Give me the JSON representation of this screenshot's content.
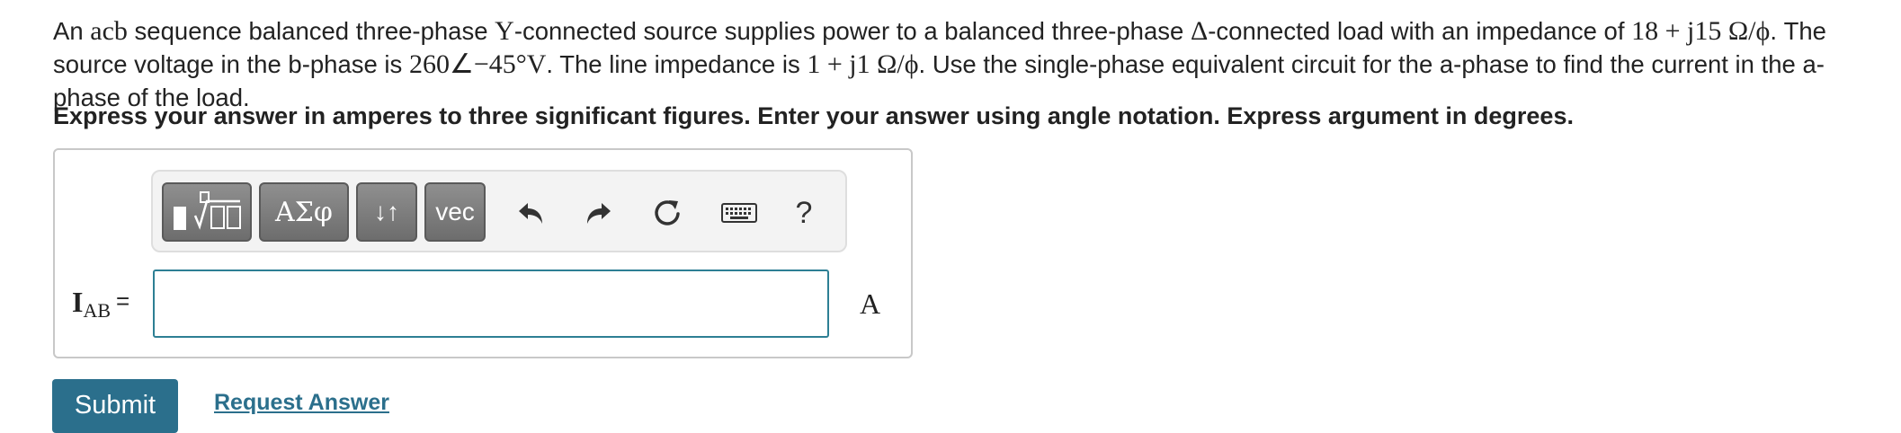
{
  "question": {
    "p1": "An ",
    "m1": "acb",
    "p2": " sequence balanced three-phase ",
    "m2": "Y",
    "p3": "-connected source supplies power to a balanced three-phase ",
    "m3": "Δ",
    "p4": "-connected load with an impedance of ",
    "m4": "18 + j15 Ω/ϕ",
    "p5": ". The source voltage in the b-phase is ",
    "m5": "260∠−45°V",
    "p6": ". The line impedance is ",
    "m6": "1 + j1 Ω/ϕ",
    "p7": ". Use the single-phase equivalent circuit for the a-phase to find the current in the a-phase of the load."
  },
  "instruction": "Express your answer in amperes to three significant figures. Enter your answer using angle notation. Express argument in degrees.",
  "toolbar": {
    "symbols_label": "ΑΣφ",
    "arrows_label": "↓↑",
    "vec_label": "vec",
    "help_label": "?"
  },
  "answer": {
    "label_main": "I",
    "label_sub": "AB",
    "equals": "=",
    "value": "",
    "unit": "A"
  },
  "actions": {
    "submit_label": "Submit",
    "request_label": "Request Answer"
  },
  "colors": {
    "accent": "#2b6f8c",
    "input_border": "#2d7f94",
    "toolbar_button": "#7a7a7a"
  },
  "icons": [
    "templates-icon",
    "undo-icon",
    "redo-icon",
    "reset-icon",
    "keyboard-icon"
  ]
}
